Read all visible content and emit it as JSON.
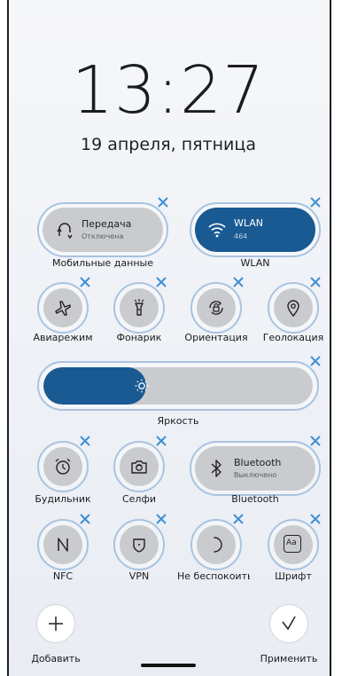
{
  "lockscreen": {
    "time": "13:27",
    "date": "19 апреля, пятница"
  },
  "tiles": {
    "mobile_data": {
      "title": "Передача",
      "subtitle": "Отключена",
      "label": "Мобильные данные",
      "active": false
    },
    "wlan": {
      "title": "WLAN",
      "subtitle": "464",
      "label": "WLAN",
      "active": true
    },
    "bluetooth": {
      "title": "Bluetooth",
      "subtitle": "Выключено",
      "label": "Bluetooth",
      "active": false
    }
  },
  "toggles": [
    {
      "label": "Авиарежим",
      "icon": "airplane-icon"
    },
    {
      "label": "Фонарик",
      "icon": "flashlight-icon"
    },
    {
      "label": "Ориентация",
      "icon": "rotation-lock-icon"
    },
    {
      "label": "Геолокация",
      "icon": "location-pin-icon"
    },
    {
      "label": "Будильник",
      "icon": "alarm-clock-icon"
    },
    {
      "label": "Селфи",
      "icon": "selfie-camera-icon"
    },
    {
      "label": "NFC",
      "icon": "nfc-icon"
    },
    {
      "label": "VPN",
      "icon": "vpn-shield-icon"
    },
    {
      "label": "Не беспокоить",
      "icon": "moon-icon"
    },
    {
      "label": "Шрифт",
      "icon": "font-icon"
    }
  ],
  "brightness": {
    "label": "Яркость",
    "level": 0.38
  },
  "actions": {
    "add": "Добавить",
    "apply": "Применить"
  },
  "font_icon_text": "Aa",
  "colors": {
    "accent": "#1a5a92",
    "remove_badge": "#3f8fd6",
    "tile_off": "#c9cbcf"
  }
}
